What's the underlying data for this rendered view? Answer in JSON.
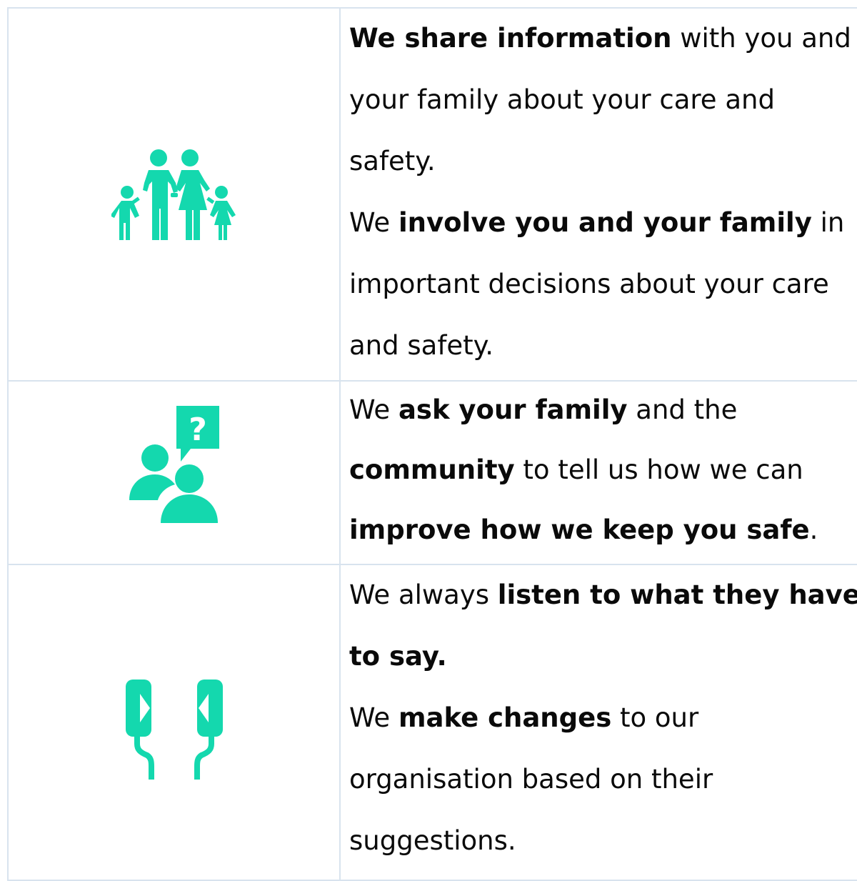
{
  "colors": {
    "icon": "#14d8ae",
    "border": "#d8e3ee"
  },
  "rows": [
    {
      "icon": "family-icon",
      "lines": [
        [
          {
            "t": "We share information",
            "b": true
          },
          {
            "t": " with you and",
            "b": false
          }
        ],
        [
          {
            "t": "your family about your care and",
            "b": false
          }
        ],
        [
          {
            "t": "safety.",
            "b": false
          }
        ],
        [
          {
            "t": "We ",
            "b": false
          },
          {
            "t": "involve you and your family",
            "b": true
          },
          {
            "t": " in",
            "b": false
          }
        ],
        [
          {
            "t": "important decisions about your care",
            "b": false
          }
        ],
        [
          {
            "t": "and safety.",
            "b": false
          }
        ]
      ]
    },
    {
      "icon": "people-question-icon",
      "lines": [
        [
          {
            "t": "We ",
            "b": false
          },
          {
            "t": "ask your family",
            "b": true
          },
          {
            "t": " and the",
            "b": false
          }
        ],
        [
          {
            "t": "community",
            "b": true
          },
          {
            "t": " to tell us how we can",
            "b": false
          }
        ],
        [
          {
            "t": "improve how we keep you safe",
            "b": true
          },
          {
            "t": ".",
            "b": false
          }
        ]
      ]
    },
    {
      "icon": "earphones-icon",
      "lines": [
        [
          {
            "t": "We always ",
            "b": false
          },
          {
            "t": "listen to what they have",
            "b": true
          }
        ],
        [
          {
            "t": "to say.",
            "b": true
          }
        ],
        [
          {
            "t": "We ",
            "b": false
          },
          {
            "t": "make changes",
            "b": true
          },
          {
            "t": " to our",
            "b": false
          }
        ],
        [
          {
            "t": "organisation based on their",
            "b": false
          }
        ],
        [
          {
            "t": "suggestions.",
            "b": false
          }
        ]
      ]
    }
  ]
}
